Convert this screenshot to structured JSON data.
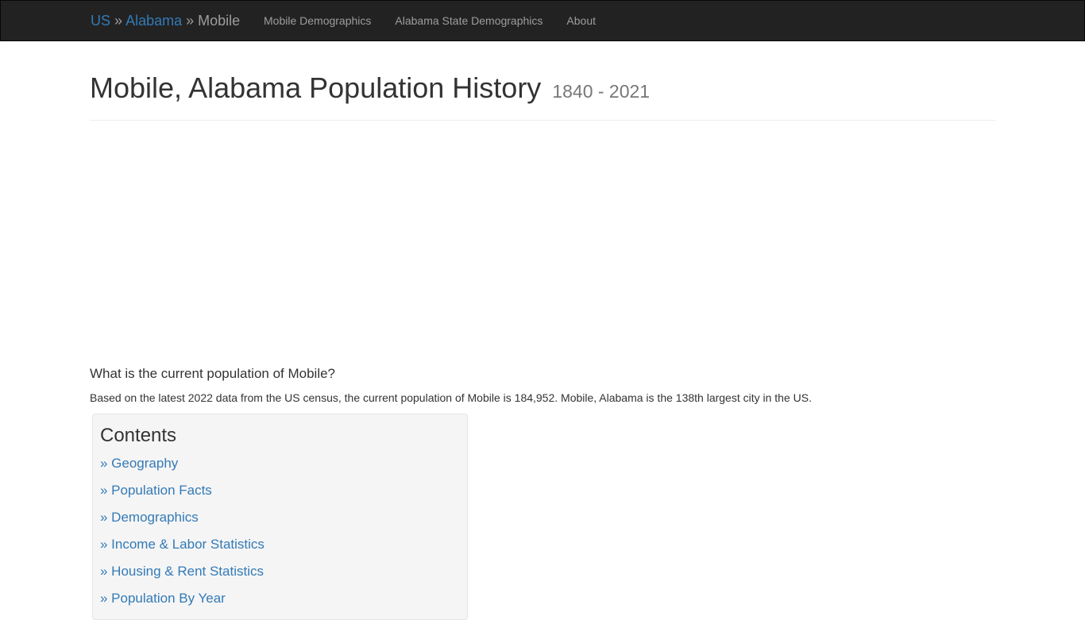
{
  "navbar": {
    "breadcrumb": {
      "root": "US",
      "separator": "»",
      "state": "Alabama",
      "city": "Mobile"
    },
    "links": [
      {
        "label": "Mobile Demographics"
      },
      {
        "label": "Alabama State Demographics"
      },
      {
        "label": "About"
      }
    ]
  },
  "header": {
    "title": "Mobile, Alabama Population History",
    "years": "1840 - 2021"
  },
  "intro": {
    "question": "What is the current population of Mobile?",
    "answer": "Based on the latest 2022 data from the US census, the current population of Mobile is 184,952. Mobile, Alabama is the 138th largest city in the US."
  },
  "contents": {
    "title": "Contents",
    "items": [
      {
        "label": "» Geography"
      },
      {
        "label": "» Population Facts"
      },
      {
        "label": "» Demographics"
      },
      {
        "label": "» Income & Labor Statistics"
      },
      {
        "label": "» Housing & Rent Statistics"
      },
      {
        "label": "» Population By Year"
      }
    ]
  },
  "colors": {
    "navbar_bg": "#222222",
    "link": "#337ab7",
    "nav_text": "#9d9d9d",
    "panel_bg": "#f5f5f5"
  }
}
